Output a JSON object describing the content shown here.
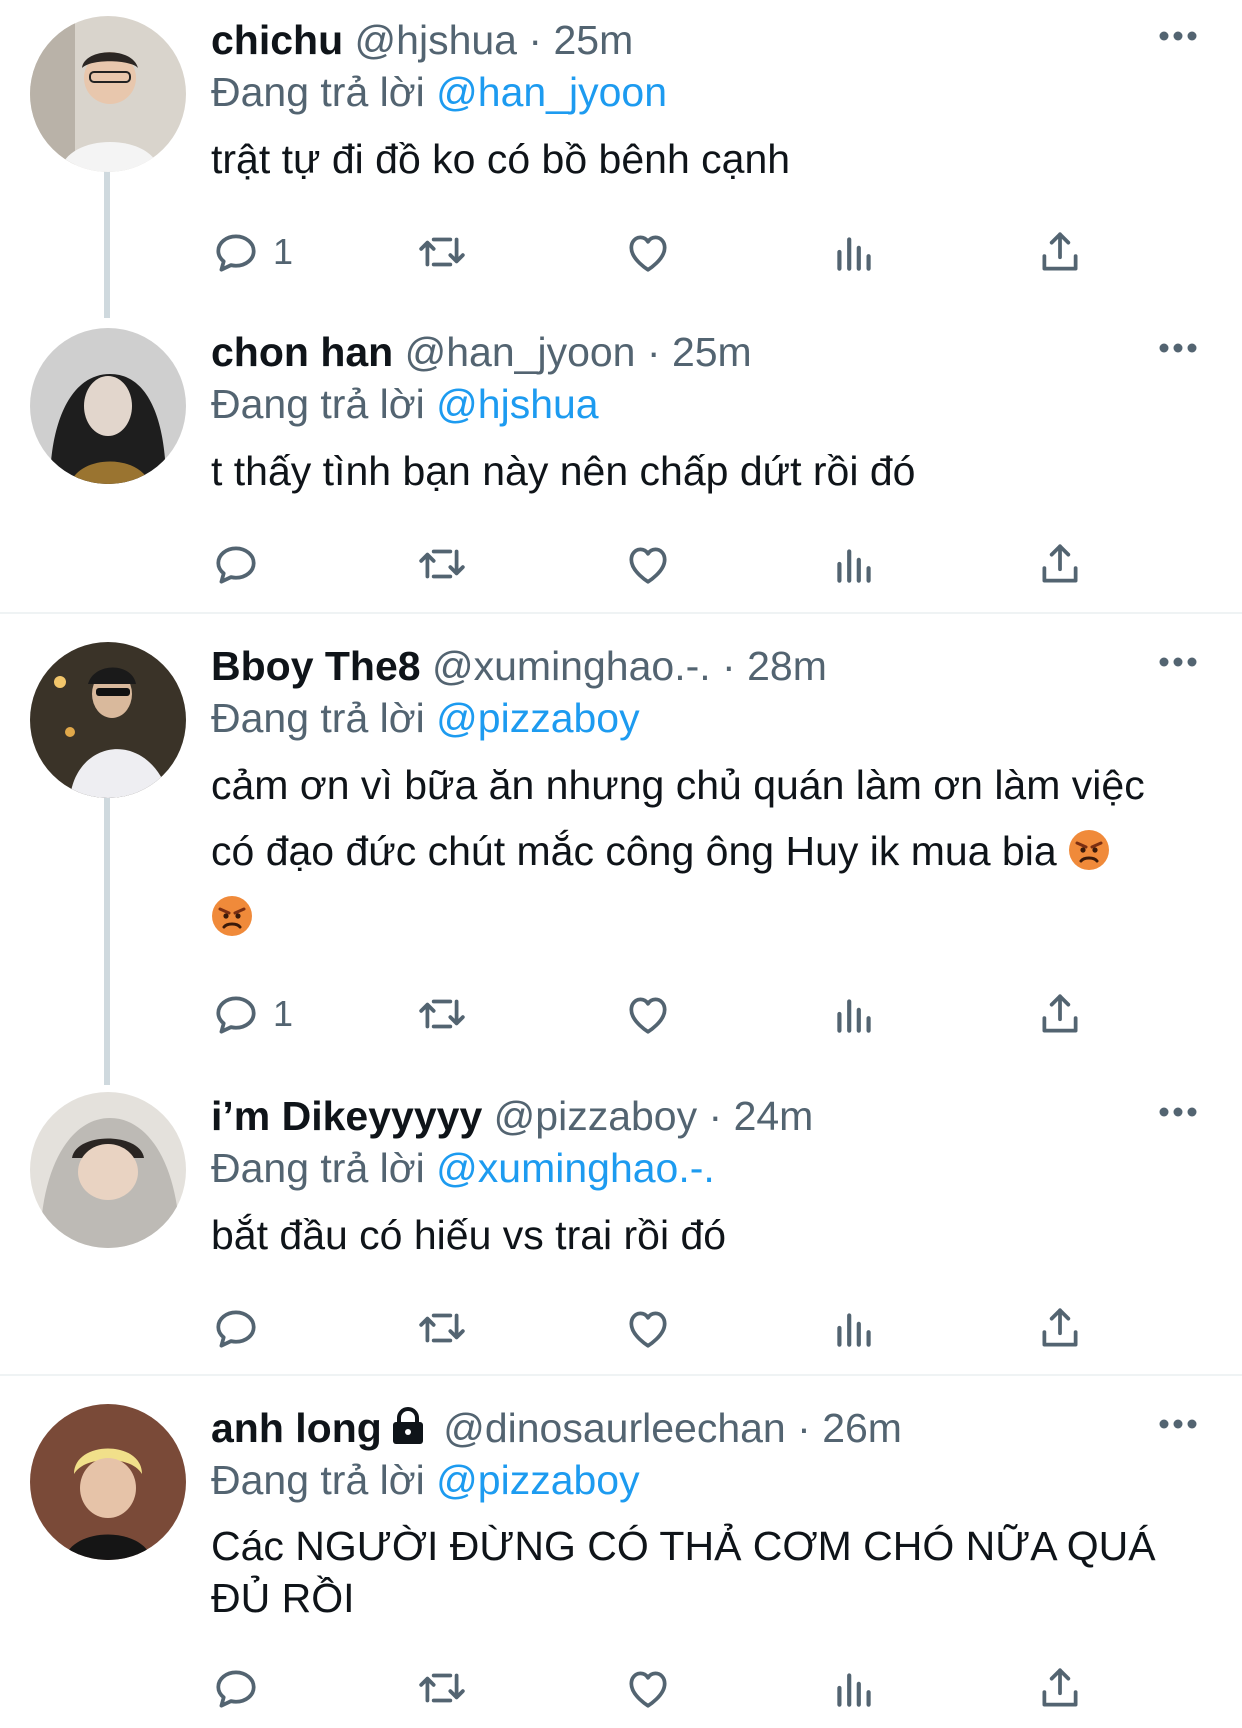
{
  "colors": {
    "accent": "#1d9bf0",
    "secondary": "#536471",
    "text": "#0f1419",
    "thread_line": "#cfd9de"
  },
  "tweets": [
    {
      "name": "chichu",
      "handle": "@hjshua",
      "time": "25m",
      "reply_prefix": "Đang trả lời",
      "reply_to": "@han_jyoon",
      "text": "trật tự đi đồ ko có bồ bênh cạnh",
      "reply_count": "1"
    },
    {
      "name": "chon han",
      "handle": "@han_jyoon",
      "time": "25m",
      "reply_prefix": "Đang trả lời",
      "reply_to": "@hjshua",
      "text": "t thấy tình bạn này nên chấp dứt rồi đó",
      "reply_count": ""
    },
    {
      "name": "Bboy The8",
      "handle": "@xuminghao.-.",
      "time": "28m",
      "reply_prefix": "Đang trả lời",
      "reply_to": "@pizzaboy",
      "text_line1": "cảm ơn vì bữa ăn nhưng chủ quán làm ơn làm việc",
      "text_line2": "có đạo đức chút mắc công ông Huy ik mua bia",
      "emoji_name": "angry-face-emoji",
      "reply_count": "1"
    },
    {
      "name": "i’m Dikeyyyyy",
      "handle": "@pizzaboy",
      "time": "24m",
      "reply_prefix": "Đang trả lời",
      "reply_to": "@xuminghao.-.",
      "text": "bắt đầu có hiếu vs trai rồi đó",
      "reply_count": ""
    },
    {
      "name": "anh long",
      "handle": "@dinosaurleechan",
      "time": "26m",
      "reply_prefix": "Đang trả lời",
      "reply_to": "@pizzaboy",
      "text_line1": "Các NGƯỜI ĐỪNG CÓ THẢ CƠM CHÓ NỮA QUÁ",
      "text_line2": "ĐỦ RỒI",
      "locked": true,
      "reply_count": ""
    }
  ],
  "icons": [
    "reply-icon",
    "retweet-icon",
    "like-icon",
    "analytics-icon",
    "share-icon",
    "more-icon",
    "lock-icon"
  ]
}
